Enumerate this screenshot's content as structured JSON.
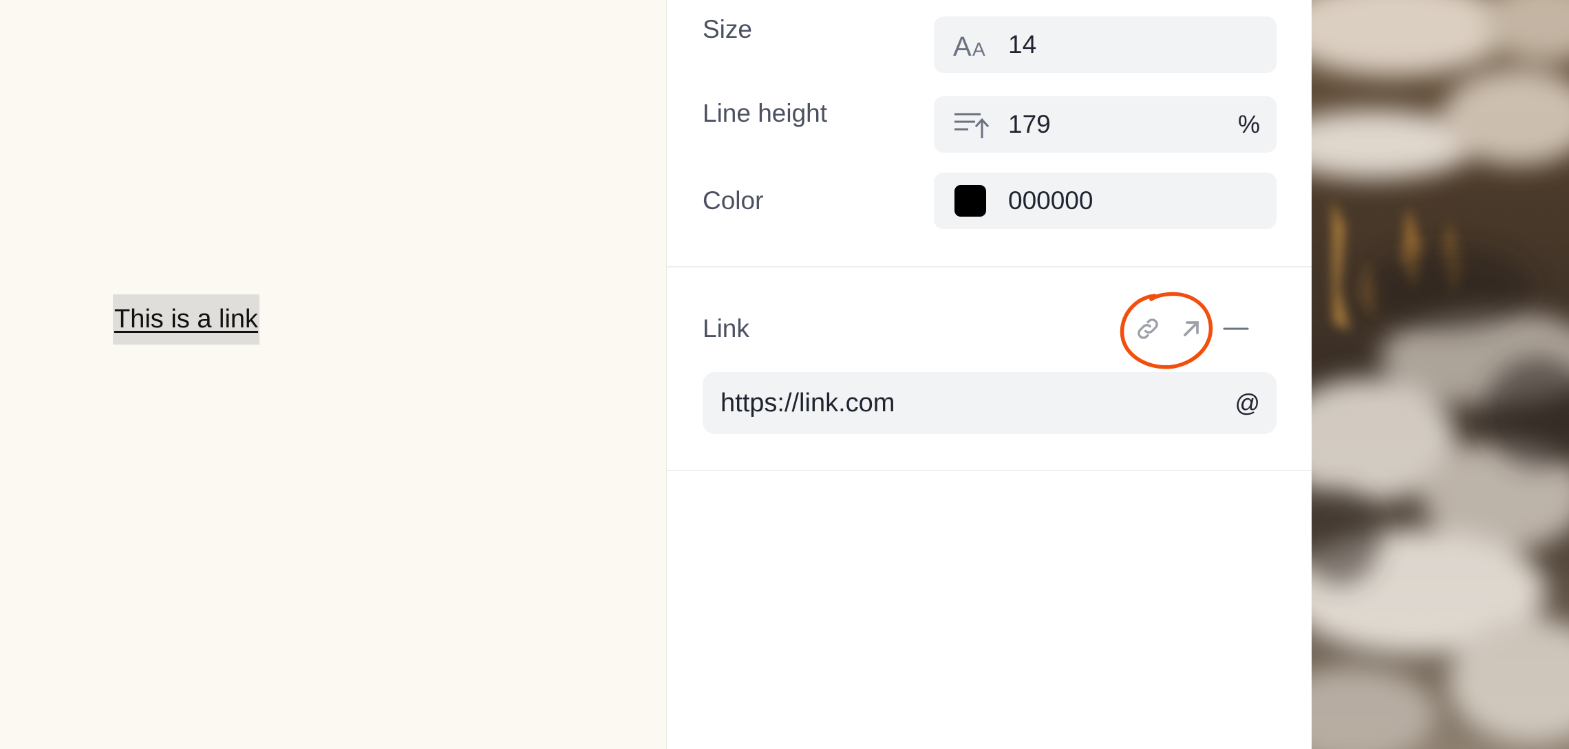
{
  "canvas": {
    "link_text": "This is a link",
    "highlight_color": "#dfdedb",
    "background_color": "#fcf9f2"
  },
  "typography": {
    "size": {
      "label": "Size",
      "icon": "font-size-icon",
      "value": "14"
    },
    "line_height": {
      "label": "Line height",
      "icon": "line-height-icon",
      "value": "179",
      "unit": "%"
    },
    "color": {
      "label": "Color",
      "swatch": "#000000",
      "value": "000000"
    }
  },
  "link_section": {
    "label": "Link",
    "actions": [
      {
        "name": "link-icon"
      },
      {
        "name": "open-external-icon"
      },
      {
        "name": "remove-icon"
      }
    ],
    "url": "https://link.com",
    "suffix": "@"
  },
  "annotation_color": "#f24e0c"
}
